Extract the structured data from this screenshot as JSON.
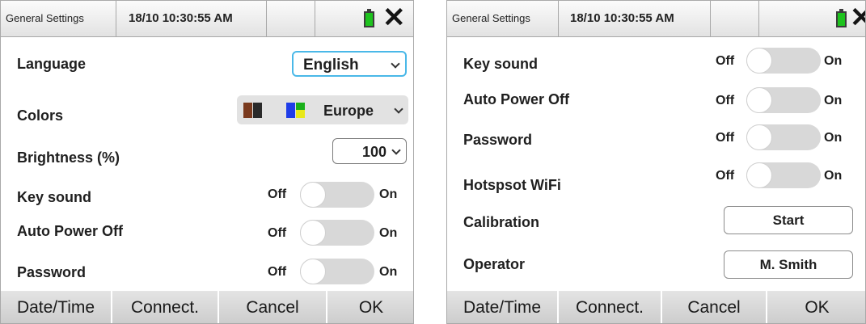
{
  "screens": [
    {
      "titlebar": {
        "title": "General Settings",
        "datetime": "18/10 10:30:55 AM",
        "battery_icon": "battery-icon",
        "close_icon": "close-icon"
      },
      "language": {
        "label": "Language",
        "value": "English"
      },
      "colors": {
        "label": "Colors",
        "value": "Europe",
        "swatches": [
          "#7a3a1e",
          "#2a2a2a",
          "#1f3de8",
          "#1ab01a",
          "#e8e81a"
        ]
      },
      "brightness": {
        "label": "Brightness (%)",
        "value": "100"
      },
      "toggles": [
        {
          "label": "Key sound",
          "off": "Off",
          "on": "On",
          "state": "off"
        },
        {
          "label": "Auto Power Off",
          "off": "Off",
          "on": "On",
          "state": "off"
        },
        {
          "label": "Password",
          "off": "Off",
          "on": "On",
          "state": "off"
        }
      ],
      "buttons": [
        "Date/Time",
        "Connect.",
        "Cancel",
        "OK"
      ]
    },
    {
      "titlebar": {
        "title": "General Settings",
        "datetime": "18/10 10:30:55 AM",
        "battery_icon": "battery-icon",
        "close_icon": "close-icon"
      },
      "toggles": [
        {
          "label": "Key sound",
          "off": "Off",
          "on": "On",
          "state": "off"
        },
        {
          "label": "Auto Power Off",
          "off": "Off",
          "on": "On",
          "state": "off"
        },
        {
          "label": "Password",
          "off": "Off",
          "on": "On",
          "state": "off"
        },
        {
          "label": "Hotspsot WiFi",
          "off": "Off",
          "on": "On",
          "state": "off"
        }
      ],
      "calibration": {
        "label": "Calibration",
        "button": "Start"
      },
      "operator": {
        "label": "Operator",
        "value": "M. Smith"
      },
      "buttons": [
        "Date/Time",
        "Connect.",
        "Cancel",
        "OK"
      ]
    }
  ],
  "colors": {
    "accent_focus": "#4ab8e8",
    "toggle_track": "#d8d8d8",
    "button_bar": "#d6d6d6",
    "battery": "#1ec31e"
  }
}
